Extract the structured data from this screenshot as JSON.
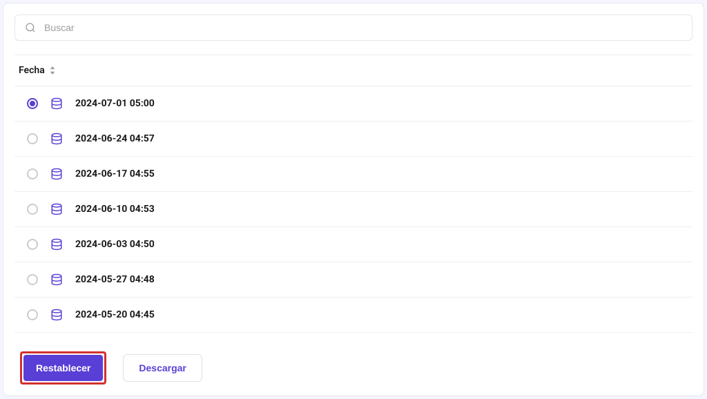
{
  "search": {
    "placeholder": "Buscar"
  },
  "header": {
    "date_label": "Fecha"
  },
  "items": [
    {
      "date": "2024-07-01 05:00",
      "selected": true
    },
    {
      "date": "2024-06-24 04:57",
      "selected": false
    },
    {
      "date": "2024-06-17 04:55",
      "selected": false
    },
    {
      "date": "2024-06-10 04:53",
      "selected": false
    },
    {
      "date": "2024-06-03 04:50",
      "selected": false
    },
    {
      "date": "2024-05-27 04:48",
      "selected": false
    },
    {
      "date": "2024-05-20 04:45",
      "selected": false
    }
  ],
  "actions": {
    "restore_label": "Restablecer",
    "download_label": "Descargar"
  },
  "colors": {
    "accent": "#5a3fd6",
    "highlight_border": "#d32f2f"
  }
}
